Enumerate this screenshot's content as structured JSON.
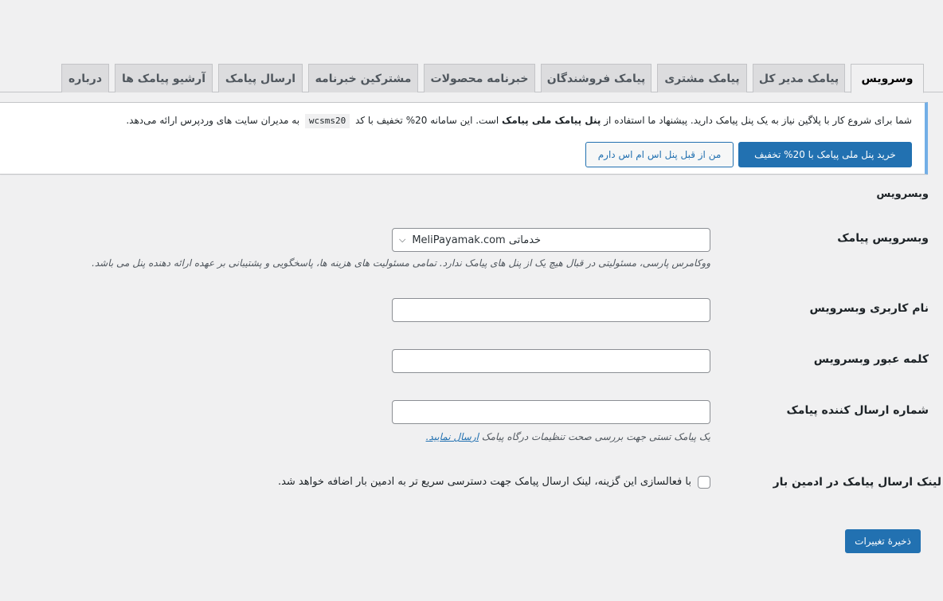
{
  "tabs": [
    {
      "label": "وسرویس",
      "active": true
    },
    {
      "label": "پیامک مدیر کل"
    },
    {
      "label": "پیامک مشتری"
    },
    {
      "label": "پیامک فروشندگان"
    },
    {
      "label": "خبرنامه محصولات"
    },
    {
      "label": "مشترکین خبرنامه"
    },
    {
      "label": "ارسال پیامک"
    },
    {
      "label": "آرشیو پیامک ها"
    },
    {
      "label": "درباره"
    }
  ],
  "notice": {
    "text_before": "شما برای شروع کار با پلاگین نیاز به یک پنل پیامک دارید. پیشنهاد ما استفاده از",
    "bold": "پنل پیامک ملی پیامک",
    "text_middle": "است. این سامانه 20% تخفیف با کد",
    "code": "wcsms20",
    "text_after": "به مدیران سایت های وردپرس ارائه می‌دهد.",
    "buy_button": "خرید پنل ملی پیامک با 20% تخفیف",
    "have_button": "من از قبل پنل اس ام اس دارم"
  },
  "settings": {
    "section_title": "وبسرویس",
    "webservice_label": "وبسرویس پیامک",
    "webservice_value": "خدماتی MeliPayamak.com",
    "webservice_desc": "ووکامرس پارسی، مسئولیتی در قبال هیچ یک از پنل های پیامک ندارد. تمامی مسئولیت های هزینه ها، پاسخگویی و پشتیبانی بر عهده ارائه دهنده پنل می باشد.",
    "username_label": "نام کاربری وبسرویس",
    "password_label": "کلمه عبور وبسرویس",
    "sender_label": "شماره ارسال کننده پیامک",
    "sender_desc": "یک پیامک تستی جهت بررسی صحت تنظیمات درگاه پیامک",
    "sender_link": "ارسال نمایید.",
    "adminbar_label": "لینک ارسال پیامک در ادمین بار",
    "adminbar_checkbox_text": "با فعالسازی این گزینه، لینک ارسال پیامک جهت دسترسی سریع تر به ادمین بار اضافه خواهد شد.",
    "save_button": "ذخیرهٔ تغییرات"
  }
}
